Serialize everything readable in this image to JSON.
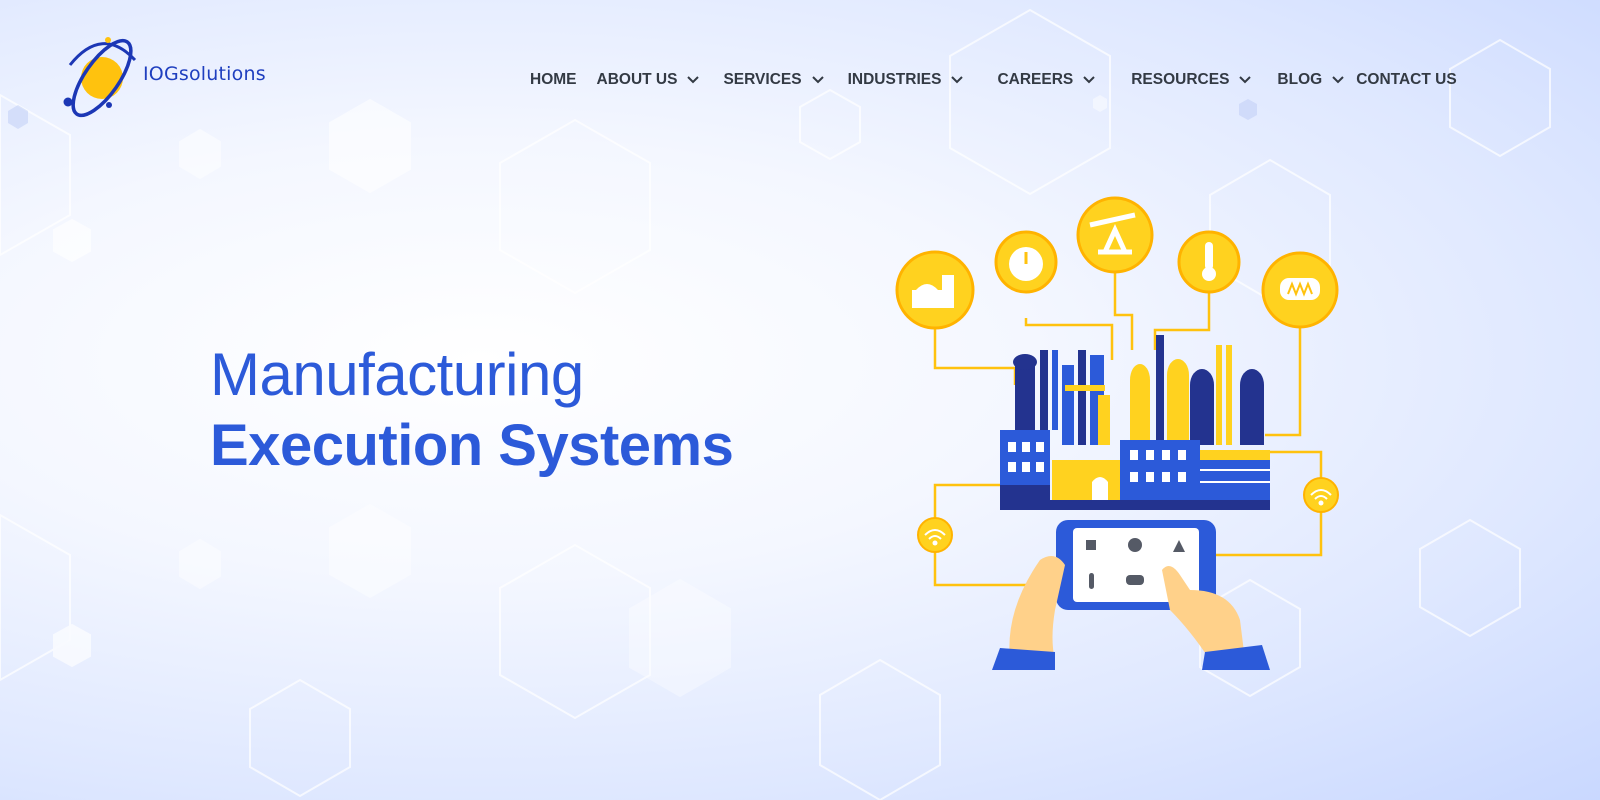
{
  "brand": {
    "name": "IOGsolutions"
  },
  "nav": {
    "items": [
      {
        "label": "HOME",
        "has_dropdown": false
      },
      {
        "label": "ABOUT US",
        "has_dropdown": true
      },
      {
        "label": "SERVICES",
        "has_dropdown": true
      },
      {
        "label": "INDUSTRIES",
        "has_dropdown": true
      },
      {
        "label": "CAREERS",
        "has_dropdown": true
      },
      {
        "label": "RESOURCES",
        "has_dropdown": true
      },
      {
        "label": "BLOG",
        "has_dropdown": true
      },
      {
        "label": "CONTACT US",
        "has_dropdown": false
      }
    ]
  },
  "hero": {
    "line1": "Manufacturing",
    "line2": "Execution Systems"
  },
  "illustration": {
    "icons": [
      "storage-tank-icon",
      "gauge-icon",
      "oil-pump-icon",
      "thermometer-icon",
      "pipeline-icon",
      "wifi-icon",
      "wifi-icon"
    ],
    "tablet_icons": [
      "storage-tank-icon",
      "gauge-icon",
      "oil-pump-icon",
      "thermometer-icon",
      "pipeline-icon"
    ]
  },
  "colors": {
    "brand_blue": "#2c5ad9",
    "accent_yellow": "#ffd21f",
    "nav_text": "#333a44",
    "factory_dark_blue": "#23338f"
  }
}
